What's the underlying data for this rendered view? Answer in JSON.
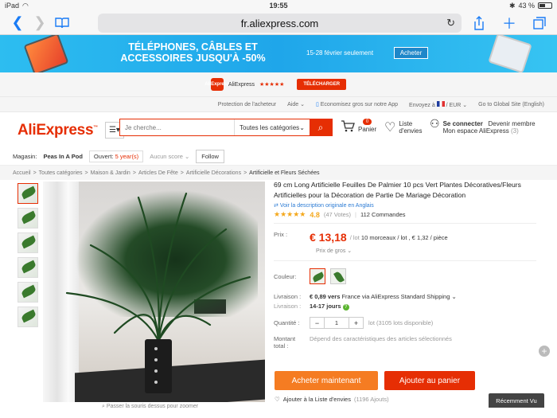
{
  "status": {
    "carrier": "iPad",
    "time": "19:55",
    "battery": "43 %"
  },
  "browser": {
    "url": "fr.aliexpress.com"
  },
  "banner": {
    "title": "TÉLÉPHONES, CÂBLES ET ACCESSOIRES JUSQU'À -50%",
    "dates": "15-28 février seulement",
    "button": "Acheter"
  },
  "appbar": {
    "logo": "AliExpress",
    "name": "AliExpress",
    "stars": "★★★★★",
    "download": "TÉLÉCHARGER"
  },
  "topnav": {
    "items": [
      "Protection de l'acheteur",
      "Aide",
      "Economisez gros sur notre App",
      "Envoyez à",
      "EUR",
      "Go to Global Site (English)"
    ]
  },
  "header": {
    "logo": "AliExpress",
    "search_placeholder": "Je cherche...",
    "search_category": "Toutes les catégories",
    "cart_count": "0",
    "cart_label": "Panier",
    "wish_label_1": "Liste",
    "wish_label_2": "d'envies",
    "signin": "Se connecter",
    "member": "Devenir membre",
    "account": "Mon espace AliExpress",
    "account_count": "(3)"
  },
  "store": {
    "label": "Magasin:",
    "name": "Peas In A Pod",
    "opened_label": "Ouvert:",
    "opened_value": "5 year(s)",
    "score": "Aucun score",
    "follow": "Follow"
  },
  "breadcrumbs": [
    "Accueil",
    "Toutes catégories",
    "Maison & Jardin",
    "Articles De Fête",
    "Artificielle Décorations",
    "Artificielle et Fleurs Séchées"
  ],
  "product": {
    "title": "69 cm Long Artificielle Feuilles De Palmier 10 pcs Vert Plantes Décoratives/Fleurs Artificielles pour la Décoration de Partie De Mariage Décoration",
    "orig_link": "Voir la description originale en Anglais",
    "stars": "★★★★★",
    "score": "4.8",
    "votes": "(47 Votes)",
    "orders": "112 Commandes",
    "price_label": "Prix :",
    "price": "€ 13,18",
    "price_unit": "/ lot",
    "price_detail": "10 morceaux / lot , € 1,32 / pièce",
    "bulk": "Prix de gros",
    "color_label": "Couleur:",
    "shipping_label": "Livraison :",
    "shipping_value": "€ 0,89 vers",
    "shipping_dest": "France via AliExpress Standard Shipping",
    "delivery_label": "Livraison :",
    "delivery_value": "14-17 jours",
    "qty_label": "Quantité :",
    "qty_value": "1",
    "qty_avail": "lot (3105 lots disponible)",
    "total_label_1": "Montant",
    "total_label_2": "total :",
    "total_value": "Dépend des caractéristiques des articles sélectionnés",
    "buy_now": "Acheter maintenant",
    "add_cart": "Ajouter au panier",
    "wishlist": "Ajouter à la Liste d'envies",
    "wishlist_count": "(1196 Ajouts)",
    "zoom_hint": "Passer la souris dessus pour zoomer"
  },
  "recent": "Récemment Vu"
}
